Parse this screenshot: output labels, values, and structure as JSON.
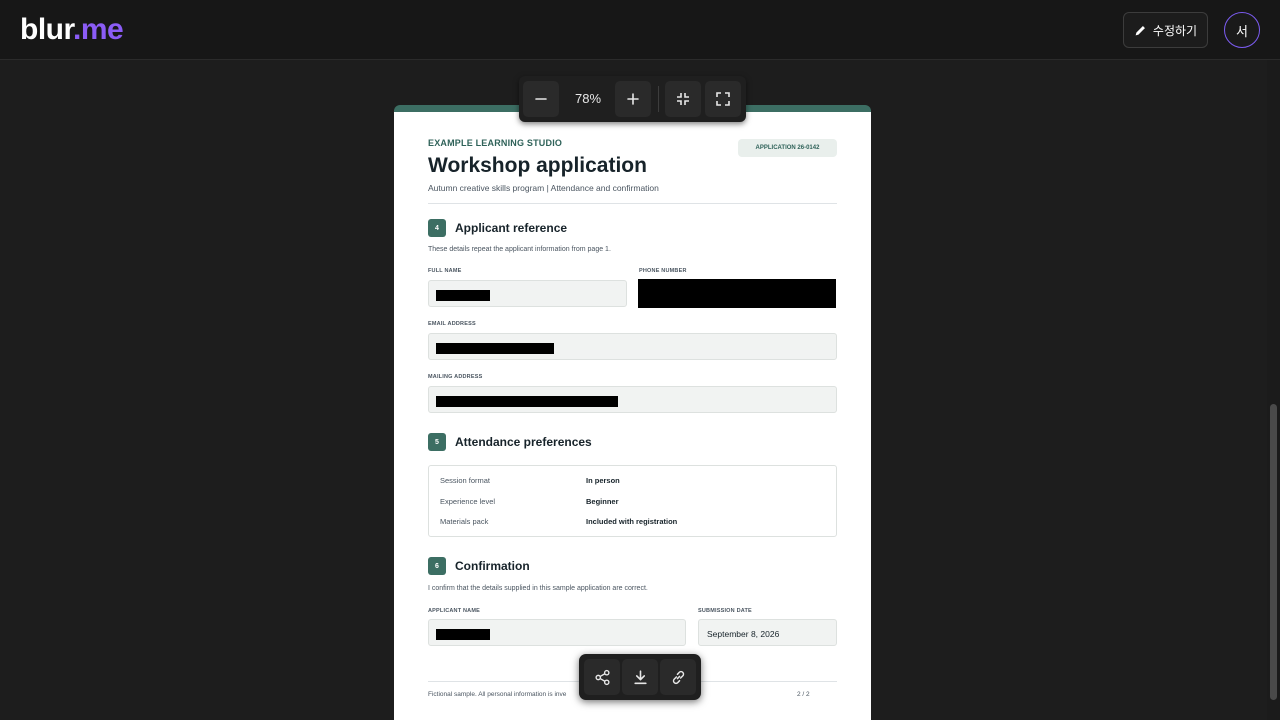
{
  "header": {
    "logo_part1": "blur",
    "logo_part2": ".me",
    "edit_label": "수정하기",
    "avatar_initial": "서"
  },
  "zoom": {
    "level": "78%"
  },
  "document": {
    "studio": "EXAMPLE LEARNING STUDIO",
    "application_id": "APPLICATION 26-0142",
    "title": "Workshop application",
    "subtitle": "Autumn creative skills program | Attendance and confirmation",
    "section4": {
      "number": "4",
      "title": "Applicant reference",
      "note": "These details repeat the applicant information from page 1.",
      "full_name_label": "FULL NAME",
      "phone_label": "PHONE NUMBER",
      "email_label": "EMAIL ADDRESS",
      "mailing_label": "MAILING ADDRESS"
    },
    "section5": {
      "number": "5",
      "title": "Attendance preferences",
      "rows": [
        {
          "key": "Session format",
          "value": "In person"
        },
        {
          "key": "Experience level",
          "value": "Beginner"
        },
        {
          "key": "Materials pack",
          "value": "Included with registration"
        }
      ]
    },
    "section6": {
      "number": "6",
      "title": "Confirmation",
      "note": "I confirm that the details supplied in this sample application are correct.",
      "applicant_name_label": "APPLICANT NAME",
      "submission_date_label": "SUBMISSION DATE",
      "submission_date_value": "September 8, 2026"
    },
    "footer_note": "Fictional sample. All personal information is inve",
    "page_number": "2 / 2"
  },
  "icons": {
    "edit": "pencil-icon",
    "zoom_out": "minus-icon",
    "zoom_in": "plus-icon",
    "fit": "collapse-icon",
    "fullscreen": "expand-icon",
    "share": "share-icon",
    "download": "download-icon",
    "link": "link-icon"
  },
  "colors": {
    "accent": "#3c6e63",
    "brand": "#8b5cf6"
  }
}
